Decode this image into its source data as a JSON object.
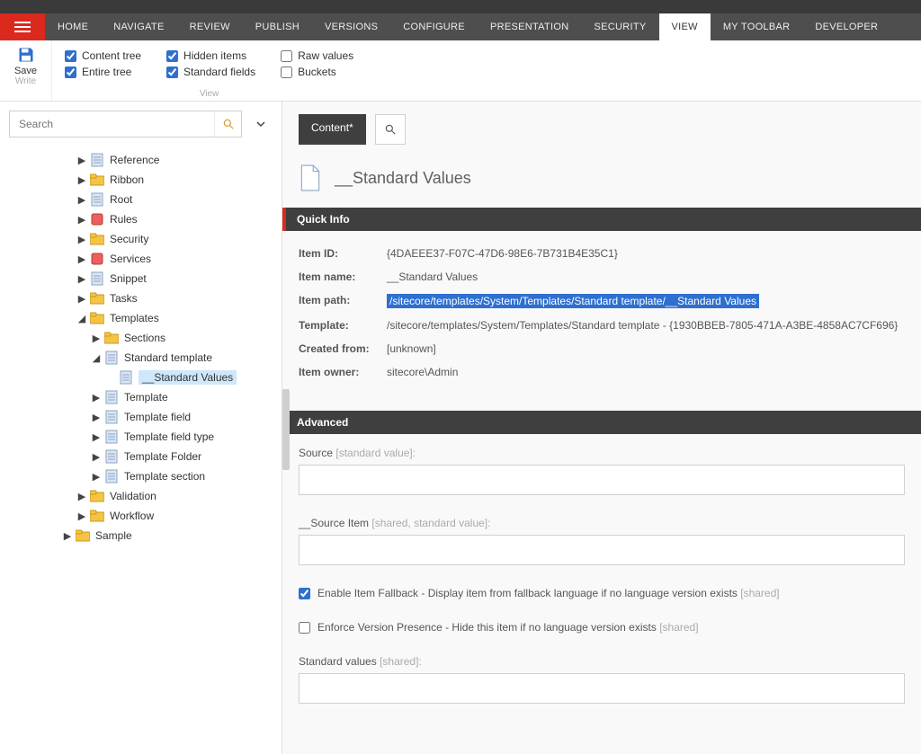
{
  "nav": {
    "tabs": [
      "HOME",
      "NAVIGATE",
      "REVIEW",
      "PUBLISH",
      "VERSIONS",
      "CONFIGURE",
      "PRESENTATION",
      "SECURITY",
      "VIEW",
      "MY TOOLBAR",
      "DEVELOPER"
    ],
    "active": "VIEW"
  },
  "ribbon": {
    "save_label": "Save",
    "save_sub": "Write",
    "group_label": "View",
    "checks": [
      {
        "label": "Content tree",
        "checked": true
      },
      {
        "label": "Hidden items",
        "checked": true
      },
      {
        "label": "Raw values",
        "checked": false
      },
      {
        "label": "Entire tree",
        "checked": true
      },
      {
        "label": "Standard fields",
        "checked": true
      },
      {
        "label": "Buckets",
        "checked": false
      }
    ]
  },
  "search": {
    "placeholder": "Search"
  },
  "tree": [
    {
      "depth": 0,
      "arrow": "▶",
      "icon": "template",
      "label": "Reference"
    },
    {
      "depth": 0,
      "arrow": "▶",
      "icon": "folder",
      "label": "Ribbon"
    },
    {
      "depth": 0,
      "arrow": "▶",
      "icon": "template",
      "label": "Root"
    },
    {
      "depth": 0,
      "arrow": "▶",
      "icon": "special",
      "label": "Rules"
    },
    {
      "depth": 0,
      "arrow": "▶",
      "icon": "folder",
      "label": "Security"
    },
    {
      "depth": 0,
      "arrow": "▶",
      "icon": "special",
      "label": "Services"
    },
    {
      "depth": 0,
      "arrow": "▶",
      "icon": "template",
      "label": "Snippet"
    },
    {
      "depth": 0,
      "arrow": "▶",
      "icon": "folder",
      "label": "Tasks"
    },
    {
      "depth": 0,
      "arrow": "◢",
      "icon": "folder",
      "label": "Templates"
    },
    {
      "depth": 1,
      "arrow": "▶",
      "icon": "folder",
      "label": "Sections"
    },
    {
      "depth": 1,
      "arrow": "◢",
      "icon": "template",
      "label": "Standard template"
    },
    {
      "depth": 2,
      "arrow": "",
      "icon": "template",
      "label": "__Standard Values",
      "selected": true
    },
    {
      "depth": 1,
      "arrow": "▶",
      "icon": "template",
      "label": "Template"
    },
    {
      "depth": 1,
      "arrow": "▶",
      "icon": "template",
      "label": "Template field"
    },
    {
      "depth": 1,
      "arrow": "▶",
      "icon": "template",
      "label": "Template field type"
    },
    {
      "depth": 1,
      "arrow": "▶",
      "icon": "template",
      "label": "Template Folder"
    },
    {
      "depth": 1,
      "arrow": "▶",
      "icon": "template",
      "label": "Template section"
    },
    {
      "depth": 0,
      "arrow": "▶",
      "icon": "folder",
      "label": "Validation"
    },
    {
      "depth": 0,
      "arrow": "▶",
      "icon": "folder",
      "label": "Workflow"
    },
    {
      "depth": -1,
      "arrow": "▶",
      "icon": "folder",
      "label": "Sample"
    }
  ],
  "content": {
    "tab_label": "Content*",
    "title": "__Standard Values",
    "quick_info_header": "Quick Info",
    "advanced_header": "Advanced",
    "quick_info": {
      "item_id_label": "Item ID:",
      "item_id": "{4DAEEE37-F07C-47D6-98E6-7B731B4E35C1}",
      "item_name_label": "Item name:",
      "item_name": "__Standard Values",
      "item_path_label": "Item path:",
      "item_path": "/sitecore/templates/System/Templates/Standard template/__Standard Values",
      "template_label": "Template:",
      "template": "/sitecore/templates/System/Templates/Standard template - {1930BBEB-7805-471A-A3BE-4858AC7CF696}",
      "created_from_label": "Created from:",
      "created_from": "[unknown]",
      "item_owner_label": "Item owner:",
      "item_owner": "sitecore\\Admin"
    },
    "fields": {
      "source_label": "Source",
      "source_hint": " [standard value]:",
      "source_value": "",
      "source_item_label": "__Source Item",
      "source_item_hint": " [shared, standard value]:",
      "source_item_value": "",
      "enable_fallback_label": "Enable Item Fallback - Display item from fallback language if no language version exists",
      "enable_fallback_hint": " [shared]",
      "enable_fallback_checked": true,
      "enforce_version_label": "Enforce Version Presence - Hide this item if no language version exists",
      "enforce_version_hint": " [shared]",
      "enforce_version_checked": false,
      "standard_values_label": "Standard values",
      "standard_values_hint": " [shared]:",
      "standard_values_value": ""
    }
  }
}
